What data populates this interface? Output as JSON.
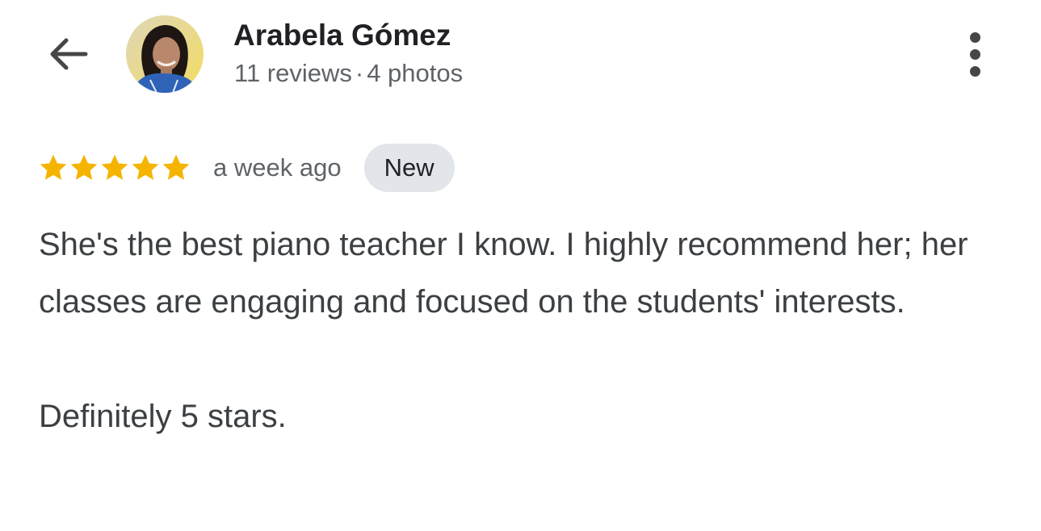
{
  "header": {
    "back_icon": "arrow-back-icon",
    "avatar_icon": "reviewer-avatar",
    "name": "Arabela Gómez",
    "reviews": "11 reviews",
    "separator": "·",
    "photos": "4 photos",
    "more_icon": "more-vertical-icon"
  },
  "review": {
    "rating": 5,
    "rating_max": 5,
    "star_icon": "star-icon",
    "star_color": "#f4b400",
    "time": "a week ago",
    "badge": "New",
    "paragraph_1": "She's the best piano teacher I know. I highly recommend her; her classes are engaging and focused on the students' interests.",
    "paragraph_2": "Definitely 5 stars."
  },
  "colors": {
    "background": "#ffffff",
    "text_primary": "#202124",
    "text_secondary": "#5f6368",
    "badge_bg": "#e2e5e9"
  }
}
